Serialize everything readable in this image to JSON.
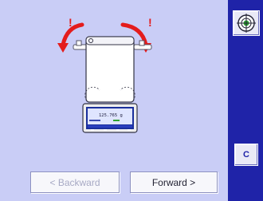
{
  "sidebar": {
    "level_icon": "level-indicator-icon",
    "clear_label": "C"
  },
  "navigation": {
    "backward_label": "< Backward",
    "forward_label": "Forward >"
  },
  "illustration": {
    "warning_mark": "!",
    "display_text": "125.765 g"
  },
  "colors": {
    "panel_background": "#c9cdf6",
    "sidebar_background": "#1f23a8",
    "arrow_red": "#e41c1c",
    "level_green": "#2fa531",
    "disabled_text": "#a7a9c4"
  }
}
